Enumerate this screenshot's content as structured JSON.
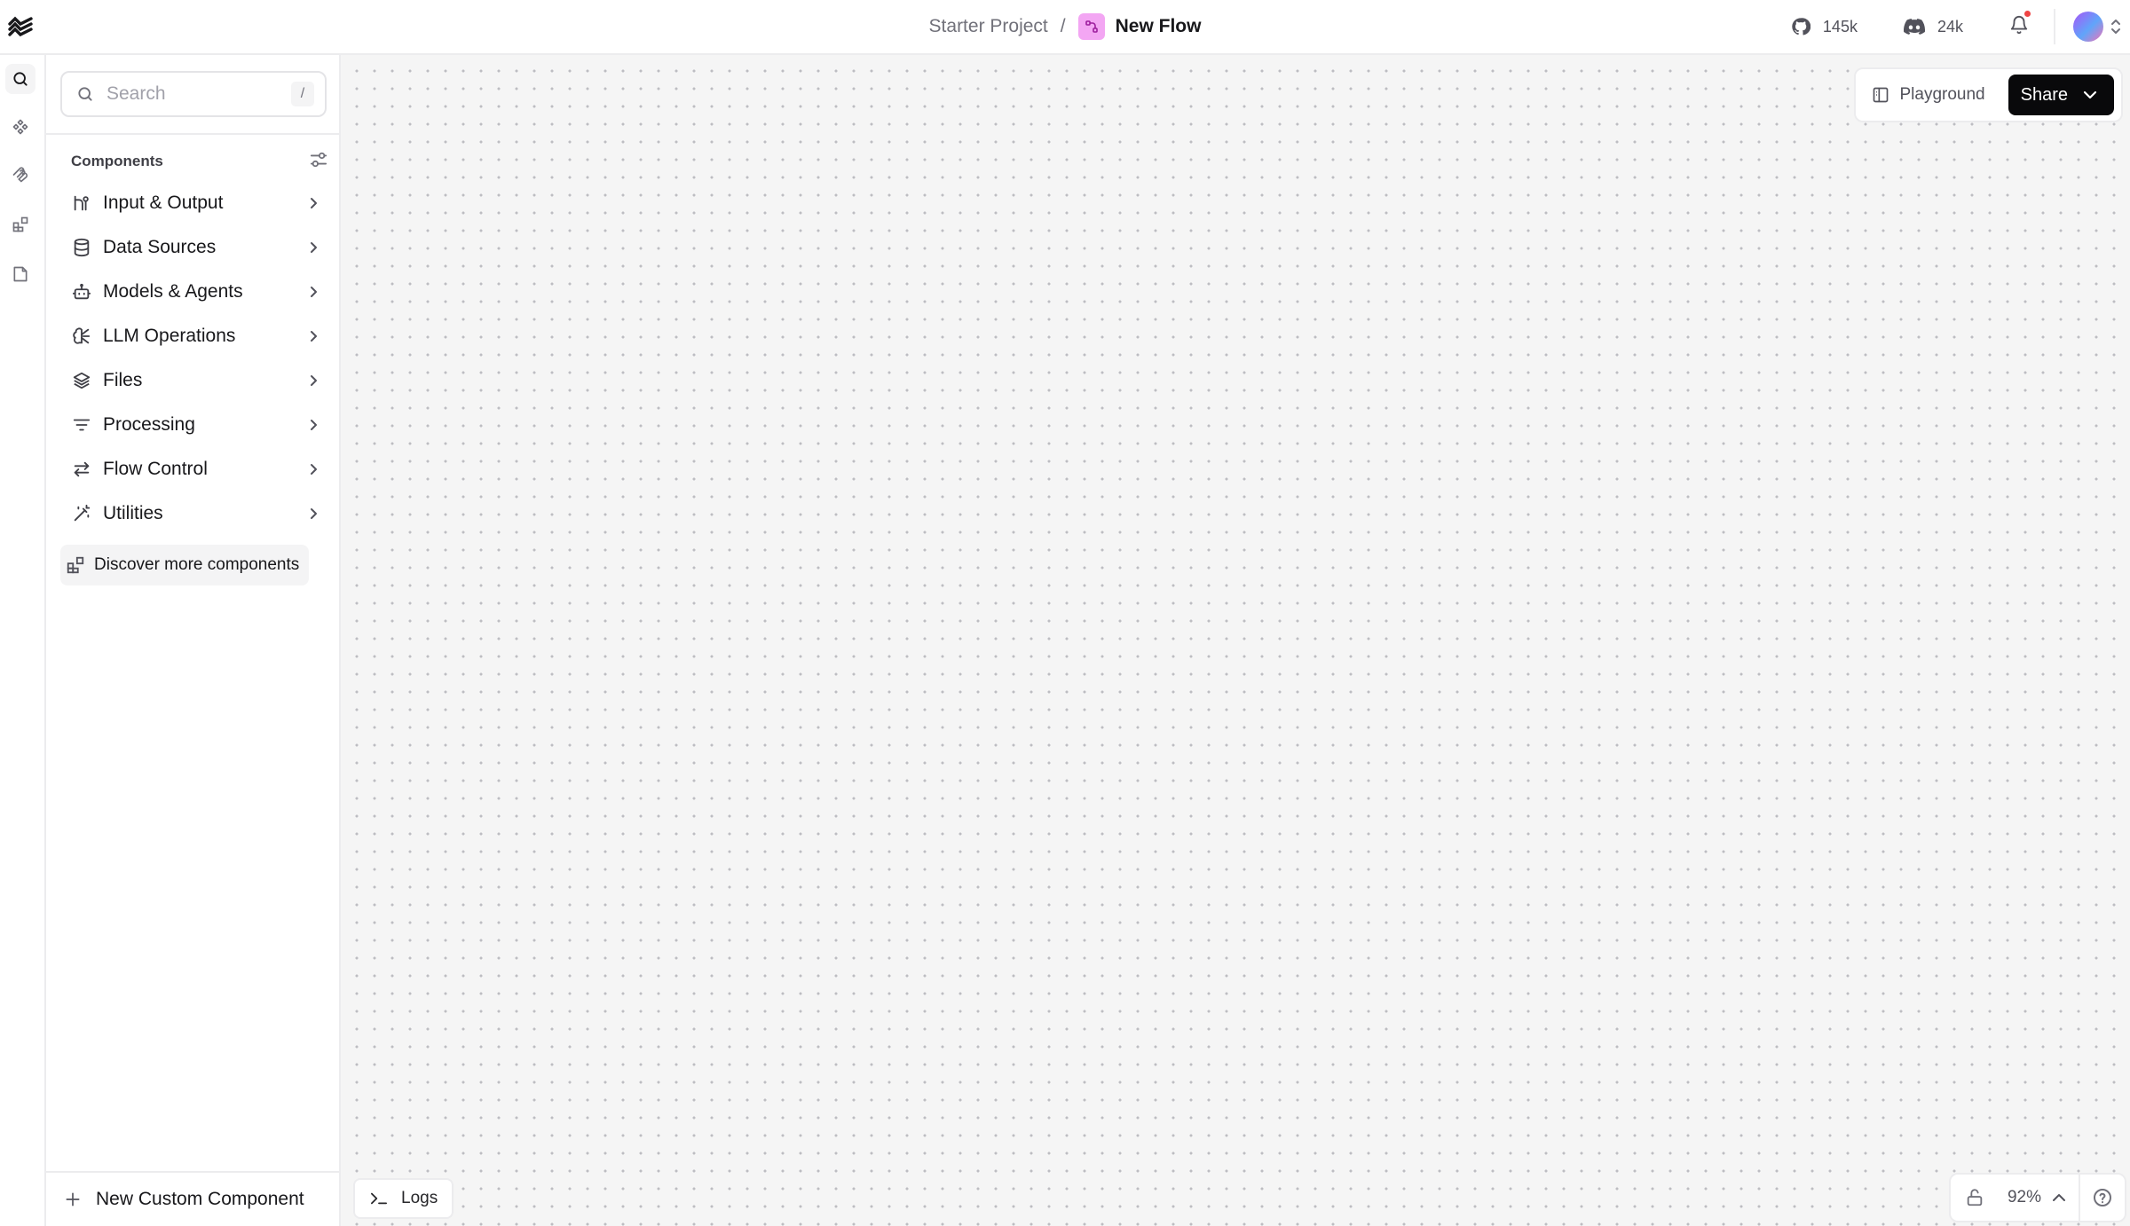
{
  "header": {
    "project": "Starter Project",
    "separator": "/",
    "flow_name": "New Flow",
    "github_stars": "145k",
    "discord_members": "24k"
  },
  "rail": {
    "icons": [
      "search-icon",
      "components-icon",
      "mcp-icon",
      "bundles-icon",
      "notes-icon"
    ]
  },
  "sidebar": {
    "search_placeholder": "Search",
    "search_shortcut": "/",
    "components_title": "Components",
    "categories": [
      {
        "label": "Input & Output",
        "icon": "input-output-icon"
      },
      {
        "label": "Data Sources",
        "icon": "database-icon"
      },
      {
        "label": "Models & Agents",
        "icon": "bot-icon"
      },
      {
        "label": "LLM Operations",
        "icon": "brain-icon"
      },
      {
        "label": "Files",
        "icon": "layers-icon"
      },
      {
        "label": "Processing",
        "icon": "filter-icon"
      },
      {
        "label": "Flow Control",
        "icon": "arrows-icon"
      },
      {
        "label": "Utilities",
        "icon": "wand-icon"
      }
    ],
    "discover_label": "Discover more components",
    "new_component_label": "New Custom Component"
  },
  "canvas": {
    "playground_label": "Playground",
    "share_label": "Share",
    "logs_label": "Logs",
    "zoom": "92%"
  },
  "colors": {
    "accent_dark": "#09090b",
    "flow_badge": "#f3a6f3",
    "notification_dot": "#ef4444",
    "canvas_bg": "#f5f5f5"
  }
}
